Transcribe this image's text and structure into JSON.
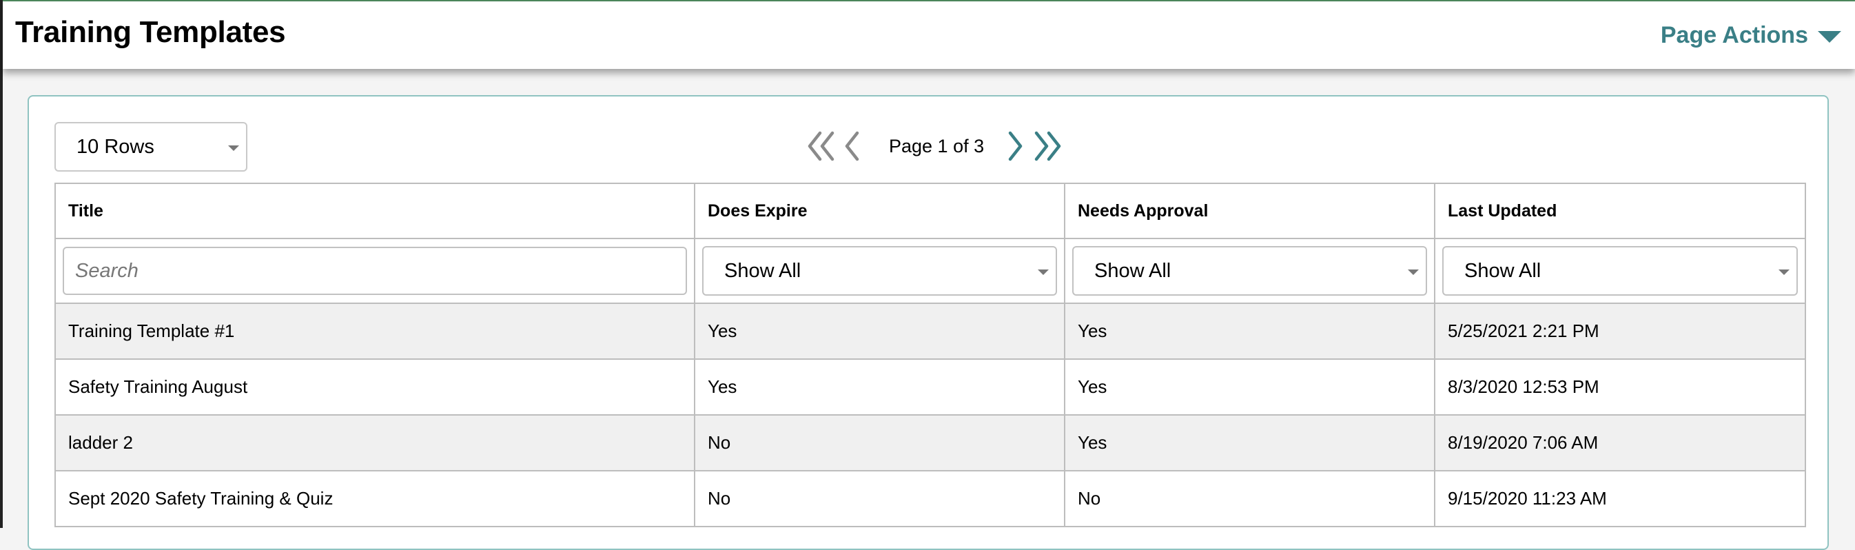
{
  "header": {
    "title": "Training Templates",
    "page_actions_label": "Page Actions"
  },
  "toolbar": {
    "rows_select_value": "10 Rows",
    "pager_text": "Page 1 of 3"
  },
  "table": {
    "columns": [
      "Title",
      "Does Expire",
      "Needs Approval",
      "Last Updated"
    ],
    "search_placeholder": "Search",
    "filters": [
      "Show All",
      "Show All",
      "Show All"
    ],
    "rows": [
      [
        "Training Template #1",
        "Yes",
        "Yes",
        "5/25/2021 2:21 PM"
      ],
      [
        "Safety Training August",
        "Yes",
        "Yes",
        "8/3/2020 12:53 PM"
      ],
      [
        "ladder 2",
        "No",
        "Yes",
        "8/19/2020 7:06 AM"
      ],
      [
        "Sept 2020 Safety Training & Quiz",
        "No",
        "No",
        "9/15/2020 11:23 AM"
      ]
    ]
  },
  "colors": {
    "accent": "#3a7f86",
    "panel_border": "#8fc3c1",
    "row_alt": "#f0f0f0",
    "pager_disabled": "#8a8a8a"
  },
  "icons": {
    "first_page": "double-chevron-left-icon",
    "prev_page": "chevron-left-icon",
    "next_page": "chevron-right-icon",
    "last_page": "double-chevron-right-icon",
    "page_actions": "caret-down-icon"
  }
}
